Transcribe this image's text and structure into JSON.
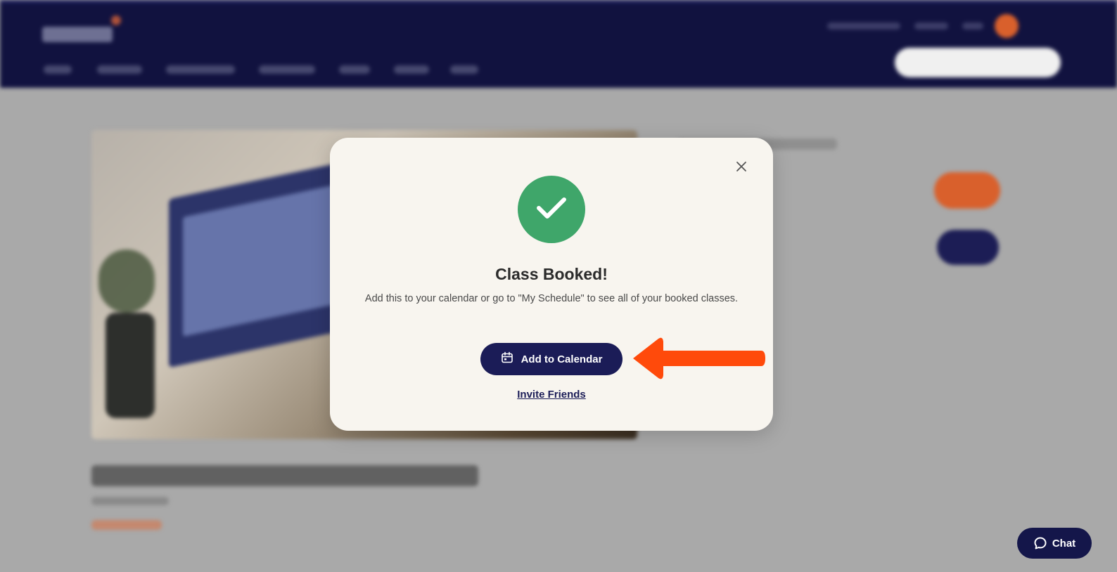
{
  "modal": {
    "title": "Class Booked!",
    "description": "Add this to your calendar or go to \"My Schedule\" to see all of your booked classes.",
    "primary_button": "Add to Calendar",
    "secondary_link": "Invite Friends",
    "icons": {
      "close": "close-icon",
      "success": "check-icon",
      "calendar": "calendar-icon"
    }
  },
  "chat": {
    "label": "Chat",
    "icon": "chat-bubble-icon"
  },
  "annotation": {
    "type": "arrow",
    "points_to": "Add to Calendar",
    "color": "#ff4a0b"
  },
  "colors": {
    "header": "#11123f",
    "accent_orange": "#d9602c",
    "navy_button": "#1b1c57",
    "success_green": "#3fa66a",
    "modal_bg": "#f8f5ef",
    "overlay": "#a9a9a9"
  }
}
